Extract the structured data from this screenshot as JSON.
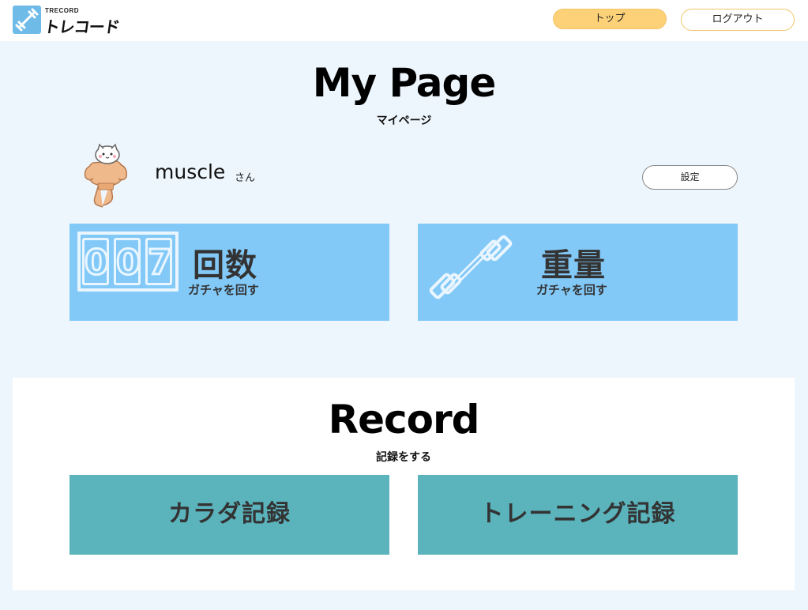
{
  "header": {
    "logo_sub": "TRECORD",
    "logo_main": "トレコード",
    "nav_top": "トップ",
    "nav_logout": "ログアウト"
  },
  "mypage": {
    "title": "My Page",
    "subtitle": "マイページ"
  },
  "profile": {
    "username": "muscle",
    "honorific": "さん",
    "settings_label": "設定"
  },
  "gacha": {
    "count": {
      "title": "回数",
      "subtitle": "ガチャを回す",
      "digits": [
        "0",
        "0",
        "7"
      ]
    },
    "weight": {
      "title": "重量",
      "subtitle": "ガチャを回す"
    }
  },
  "record": {
    "title": "Record",
    "subtitle": "記録をする",
    "body_label": "カラダ記録",
    "training_label": "トレーニング記録"
  },
  "colors": {
    "background": "#eef6fd",
    "accent_yellow": "#fdd178",
    "card_blue": "#82c9f8",
    "record_teal": "#5bb3bc"
  }
}
